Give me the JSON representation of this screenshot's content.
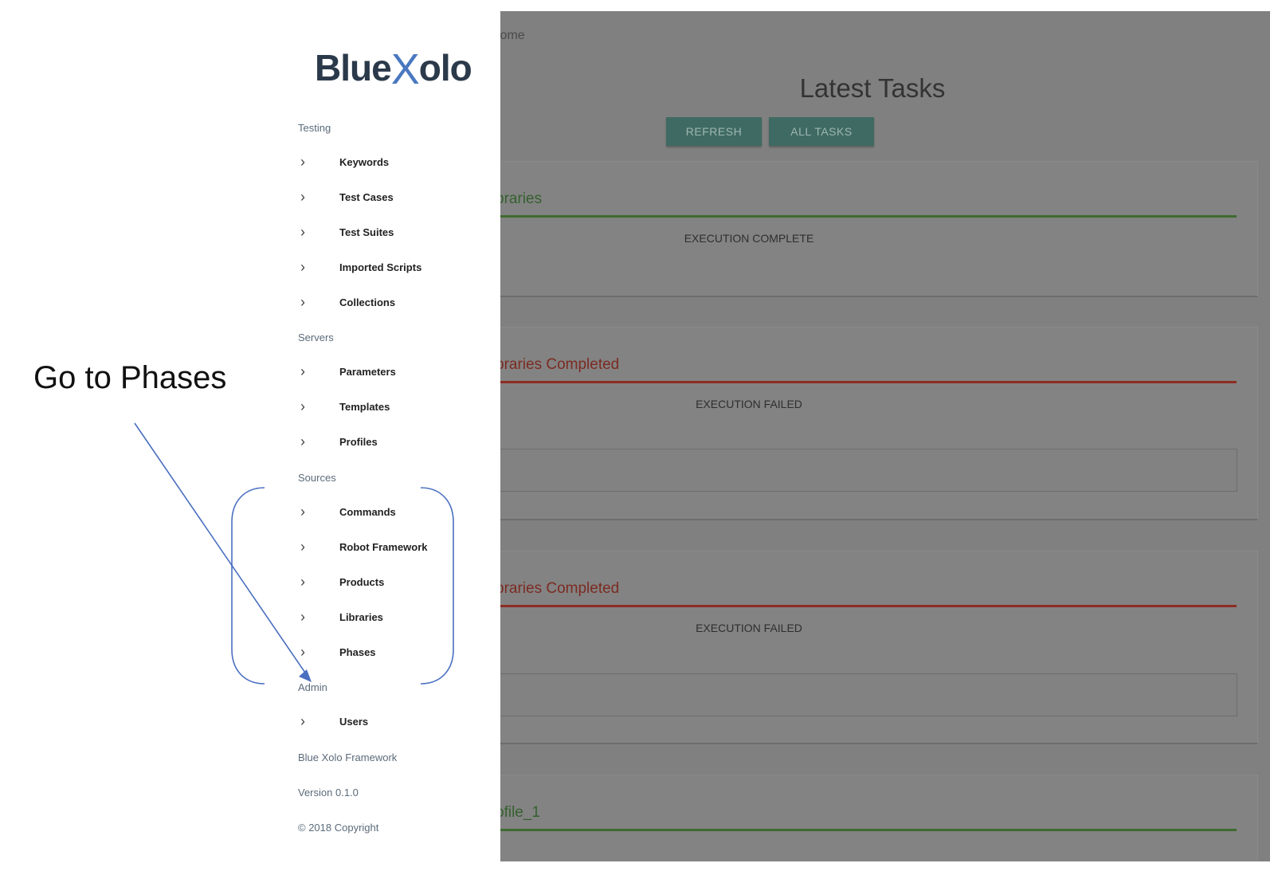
{
  "annotation": {
    "text": "Go to Phases"
  },
  "main": {
    "breadcrumb": "Home",
    "title": "Latest Tasks",
    "buttons": {
      "refresh": "REFRESH",
      "all_tasks": "ALL TASKS"
    },
    "cards": [
      {
        "title": "braries",
        "status": "EXECUTION COMPLETE"
      },
      {
        "title": "braries Completed",
        "status": "EXECUTION FAILED"
      },
      {
        "title": "braries Completed",
        "status": "EXECUTION FAILED"
      },
      {
        "title": "ofile_1"
      }
    ]
  },
  "sidebar": {
    "logo": {
      "left": "Blue",
      "x": "X",
      "right": "olo"
    },
    "sections": {
      "testing": "Testing",
      "servers": "Servers",
      "sources": "Sources",
      "admin": "Admin"
    },
    "items": {
      "keywords": "Keywords",
      "test_cases": "Test Cases",
      "test_suites": "Test Suites",
      "imported_scripts": "Imported Scripts",
      "collections": "Collections",
      "parameters": "Parameters",
      "templates": "Templates",
      "profiles": "Profiles",
      "commands": "Commands",
      "robot_framework": "Robot Framework",
      "products": "Products",
      "libraries": "Libraries",
      "phases": "Phases",
      "users": "Users"
    },
    "footer": {
      "framework": "Blue Xolo Framework",
      "version": "Version 0.1.0",
      "copyright": "© 2018 Copyright"
    },
    "chevron_icon": "chevron-right-icon"
  },
  "colors": {
    "overlay": "#808080",
    "button": "#3f6a63",
    "success_line": "#3e6b2f",
    "fail_line": "#8d2d24",
    "annotation": "#4a6fc0"
  }
}
